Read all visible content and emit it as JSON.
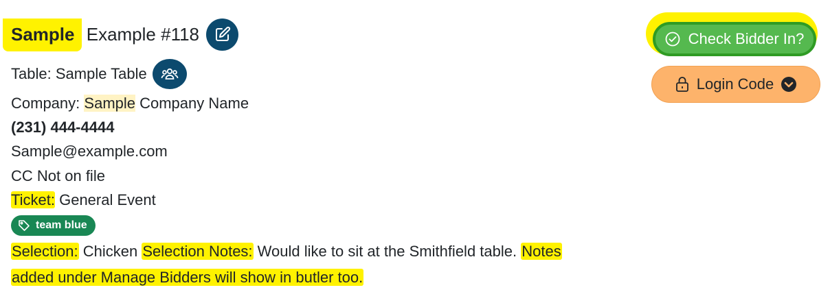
{
  "bidder": {
    "name_first": "Sample",
    "name_rest": " Example #118",
    "table_label": "Table:",
    "table_value": "Sample Table",
    "company_label": "Company:",
    "company_first": "Sample",
    "company_rest": " Company Name",
    "phone": "(231) 444-4444",
    "email": "Sample@example.com",
    "cc_status": "CC Not on file",
    "ticket_label": "Ticket:",
    "ticket_value": " General Event",
    "tag": "team blue",
    "selection_label": "Selection:",
    "selection_value": " Chicken ",
    "selection_notes_label": "Selection Notes:",
    "selection_notes_value": " Would like to sit at the Smithfield table. ",
    "notes_label_1": "Notes",
    "notes_label_2": "added under Manage Bidders will show in butler too."
  },
  "actions": {
    "check_in_label": "Check Bidder In?",
    "login_code_label": "Login Code"
  },
  "icons": {
    "edit": "edit-icon",
    "table": "users-icon",
    "tag": "tag-icon",
    "check": "check-circle-icon",
    "lock": "lock-icon",
    "dropdown": "chevron-down-circle-icon"
  },
  "colors": {
    "icon_button": "#0c4a6e",
    "tag": "#198754",
    "check_in": "#55b94f",
    "login_code": "#fdb36b",
    "highlight": "#fff200"
  }
}
